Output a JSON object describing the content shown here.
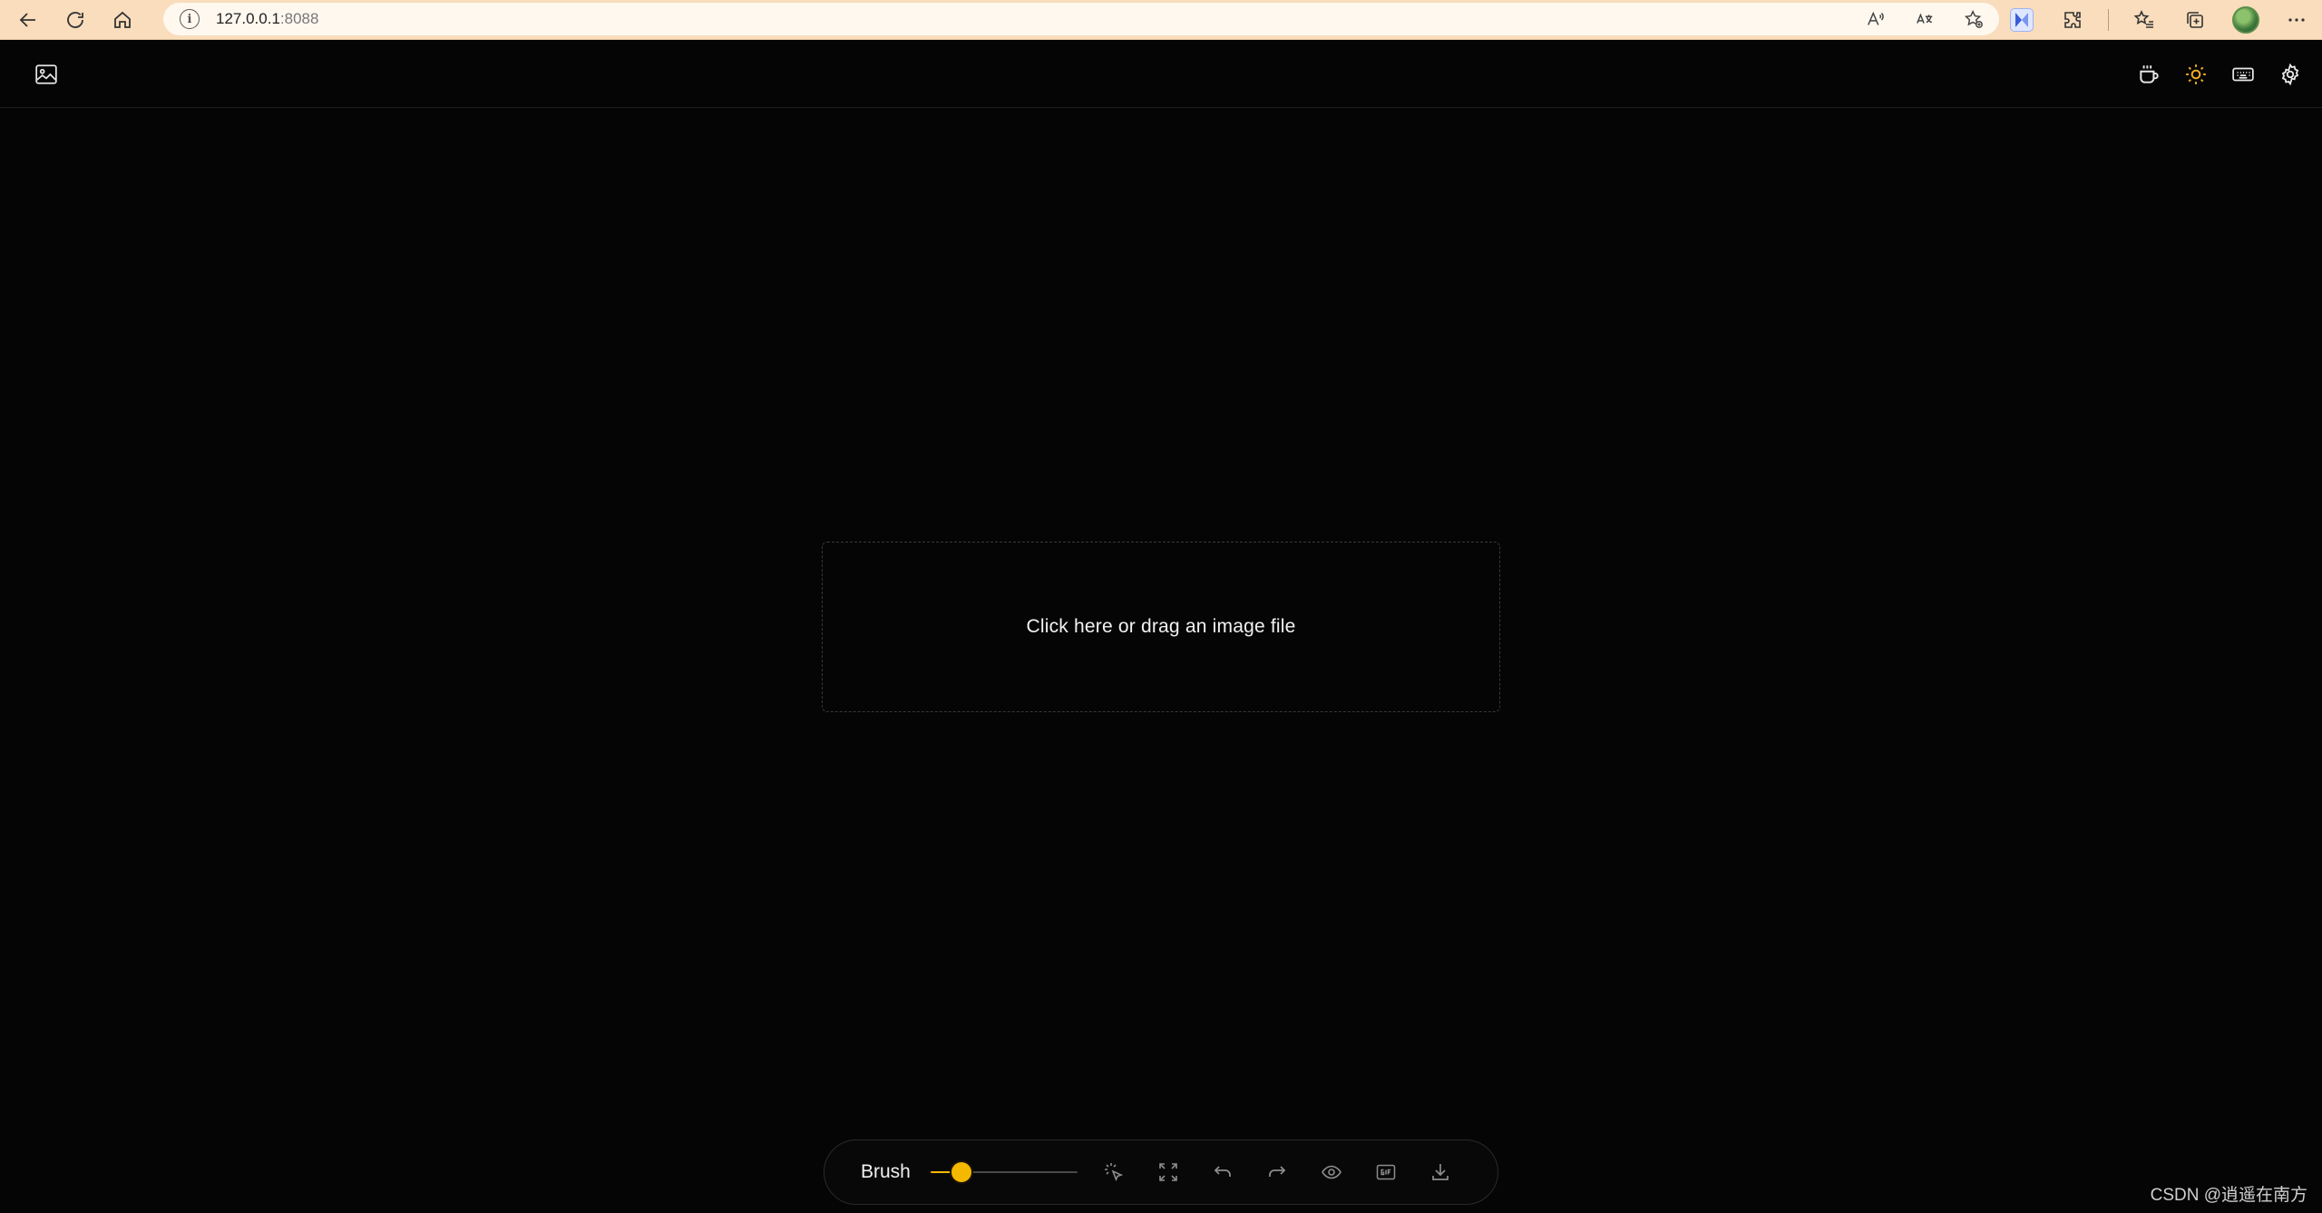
{
  "browser": {
    "url_host": "127.0.0.1",
    "url_port": ":8088",
    "icons": {
      "back": "arrow-left-icon",
      "refresh": "refresh-icon",
      "home": "home-icon",
      "site_info": "info-icon",
      "read_aloud": "read-aloud-icon",
      "translate": "translate-icon",
      "favorite_add": "star-plus-icon",
      "extension": "extension-badge-icon",
      "extensions": "puzzle-icon",
      "favorites": "favorites-list-icon",
      "collections": "collections-icon",
      "profile": "avatar",
      "menu": "more-icon"
    },
    "chrome_color": "#f9ddbc"
  },
  "header": {
    "left_icon": "image-icon",
    "right_icons": [
      "coffee-cup-icon",
      "sun-icon",
      "keyboard-icon",
      "gear-icon"
    ],
    "accent_color": "#f2b01e"
  },
  "upload": {
    "prompt": "Click here or drag an image file"
  },
  "toolbar": {
    "brush_label": "Brush",
    "brush_size_fraction": 0.21,
    "slider_color": "#f5b800",
    "tools": [
      "magic-cursor-icon",
      "fullscreen-icon",
      "undo-icon",
      "redo-icon",
      "eye-icon",
      "gif-icon",
      "download-icon"
    ]
  },
  "watermark": "CSDN @逍遥在南方"
}
